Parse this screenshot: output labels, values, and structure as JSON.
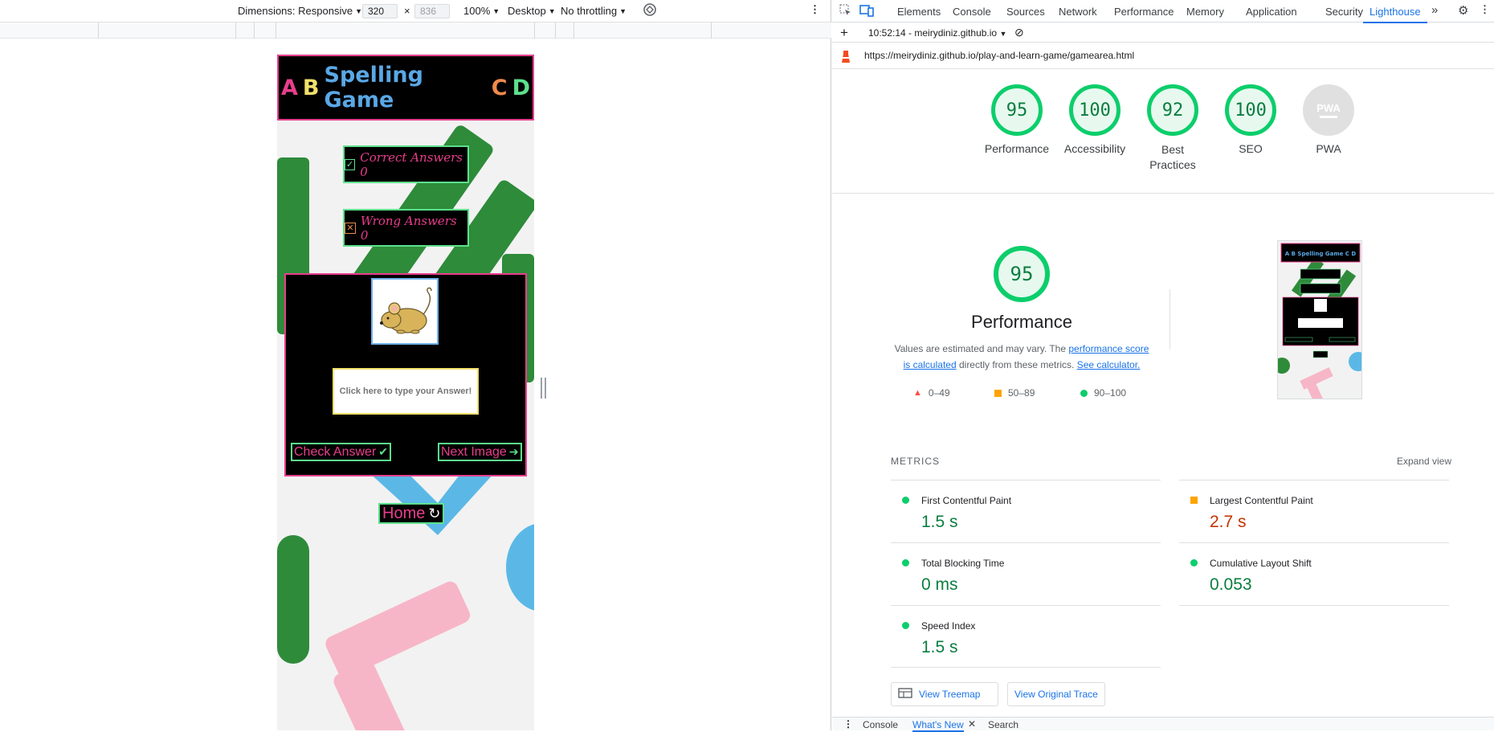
{
  "device_toolbar": {
    "dimensions_label": "Dimensions: Responsive",
    "width_value": "320",
    "times": "×",
    "height_placeholder": "836",
    "zoom": "100%",
    "device_type": "Desktop",
    "throttling": "No throttling"
  },
  "game": {
    "title_letters": [
      {
        "text": "A",
        "color": "#e83e8c"
      },
      {
        "text": "B",
        "color": "#f1e06a"
      },
      {
        "text": "Spelling Game",
        "color": "#5aa8e6"
      },
      {
        "text": "C",
        "color": "#f08a4b"
      },
      {
        "text": "D",
        "color": "#5de08c"
      }
    ],
    "correct_label": "Correct Answers 0",
    "wrong_label": "Wrong Answers 0",
    "answer_placeholder": "Click here to type your Answer!",
    "check_button": "Check Answer",
    "next_button": "Next Image",
    "home_button": "Home"
  },
  "devtools": {
    "tabs": [
      "Elements",
      "Console",
      "Sources",
      "Network",
      "Performance",
      "Memory",
      "Application",
      "Security",
      "Lighthouse"
    ],
    "active_tab": "Lighthouse",
    "report_time": "10:52:14 - meirydiniz.github.io",
    "url": "https://meirydiniz.github.io/play-and-learn-game/gamearea.html",
    "scores": [
      {
        "value": "95",
        "label": "Performance"
      },
      {
        "value": "100",
        "label": "Accessibility"
      },
      {
        "value": "92",
        "label": "Best Practices"
      },
      {
        "value": "100",
        "label": "SEO"
      },
      {
        "value": "PWA",
        "label": "PWA"
      }
    ],
    "main_score": "95",
    "main_title": "Performance",
    "desc_prefix": "Values are estimated and may vary. The ",
    "desc_link1": "performance score is calculated",
    "desc_middle": " directly from these metrics. ",
    "desc_link2": "See calculator.",
    "legend": [
      "0–49",
      "50–89",
      "90–100"
    ],
    "metrics_heading": "METRICS",
    "expand_view": "Expand view",
    "metrics": [
      {
        "name": "First Contentful Paint",
        "value": "1.5 s",
        "status": "good"
      },
      {
        "name": "Largest Contentful Paint",
        "value": "2.7 s",
        "status": "average"
      },
      {
        "name": "Total Blocking Time",
        "value": "0 ms",
        "status": "good"
      },
      {
        "name": "Cumulative Layout Shift",
        "value": "0.053",
        "status": "good"
      },
      {
        "name": "Speed Index",
        "value": "1.5 s",
        "status": "good"
      }
    ],
    "view_treemap": "View Treemap",
    "view_trace": "View Original Trace",
    "drawer_tabs": [
      "Console",
      "What's New",
      "Search"
    ],
    "colors": {
      "good": "#0cce6b",
      "average": "#ffa400",
      "poor": "#ff4e42",
      "accent": "#1a73e8"
    }
  }
}
